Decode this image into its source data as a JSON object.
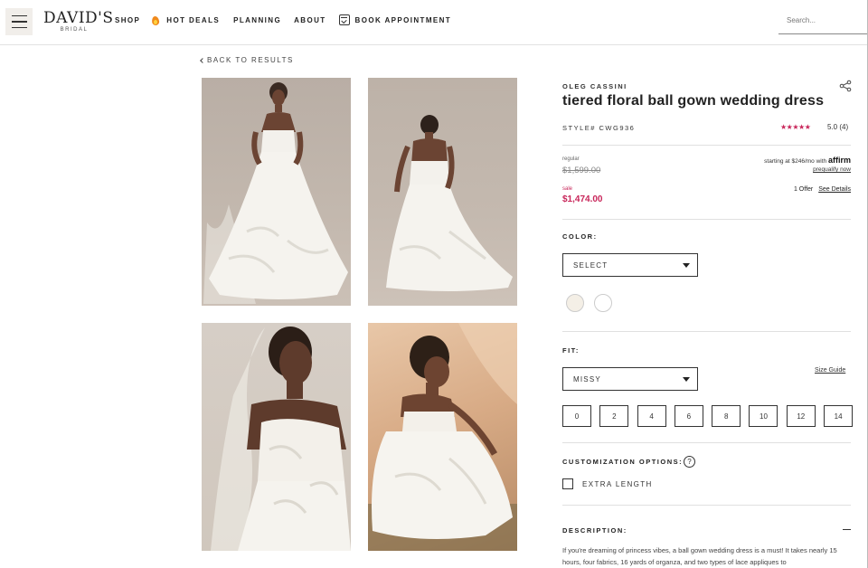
{
  "header": {
    "logo_main": "DAVID'S",
    "logo_sub": "BRIDAL",
    "nav": {
      "shop": "SHOP",
      "hot_deals": "HOT DEALS",
      "planning": "PLANNING",
      "about": "ABOUT",
      "book": "BOOK APPOINTMENT"
    },
    "search_placeholder": "Search..."
  },
  "back_link": "BACK TO RESULTS",
  "product": {
    "brand": "OLEG CASSINI",
    "title": "tiered floral ball gown wedding dress",
    "style": "STYLE# CWG936",
    "stars": "★★★★★",
    "rating": "5.0 (4)",
    "regular_label": "regular",
    "regular_price": "$1,599.00",
    "sale_label": "sale",
    "sale_price": "$1,474.00",
    "affirm_text": "starting at $246/mo with",
    "affirm_logo": "affirm",
    "prequalify": "prequalify now",
    "offer_count": "1 Offer",
    "offer_link": "See Details"
  },
  "color": {
    "label": "COLOR:",
    "select_value": "SELECT",
    "swatches": [
      "#f4efe6",
      "#ffffff"
    ]
  },
  "fit": {
    "label": "FIT:",
    "select_value": "MISSY",
    "size_guide": "Size Guide",
    "sizes": [
      "0",
      "2",
      "4",
      "6",
      "8",
      "10",
      "12",
      "14"
    ]
  },
  "customization": {
    "label": "CUSTOMIZATION OPTIONS:",
    "help": "?",
    "option": "EXTRA LENGTH"
  },
  "description": {
    "label": "DESCRIPTION:",
    "text": "If you're dreaming of princess vibes, a ball gown wedding dress is a must! It takes nearly 15 hours, four fabrics, 16 yards of organza, and two types of lace appliques to"
  },
  "colors": {
    "accent": "#c8265a",
    "text": "#222222"
  }
}
